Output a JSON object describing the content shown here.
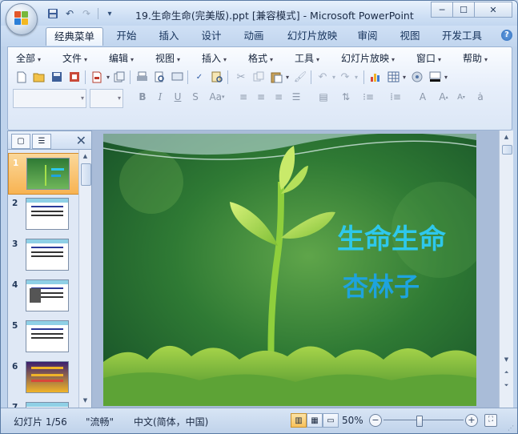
{
  "window": {
    "title": "19.生命生命(完美版).ppt [兼容模式] - Microsoft PowerPoint",
    "controls": {
      "minimize": "─",
      "maximize": "☐",
      "close": "✕"
    }
  },
  "qat": {
    "save_icon": "save-icon",
    "undo_icon": "undo-icon",
    "redo_icon": "redo-icon",
    "customize": "▾"
  },
  "tabs": [
    {
      "label": "经典菜单"
    },
    {
      "label": "开始"
    },
    {
      "label": "插入"
    },
    {
      "label": "设计"
    },
    {
      "label": "动画"
    },
    {
      "label": "幻灯片放映"
    },
    {
      "label": "审阅"
    },
    {
      "label": "视图"
    },
    {
      "label": "开发工具"
    }
  ],
  "help_label": "?",
  "menu": [
    {
      "label": "全部"
    },
    {
      "label": "文件"
    },
    {
      "label": "编辑"
    },
    {
      "label": "视图"
    },
    {
      "label": "插入"
    },
    {
      "label": "格式"
    },
    {
      "label": "工具"
    },
    {
      "label": "幻灯片放映"
    },
    {
      "label": "窗口"
    },
    {
      "label": "帮助"
    }
  ],
  "format_buttons": {
    "bold": "B",
    "italic": "I",
    "underline": "U",
    "strike": "S",
    "case": "Aa"
  },
  "slide": {
    "title": "生命生命",
    "subtitle": "杏林子",
    "title_color": "#2ec8ec",
    "subtitle_color": "#1ea3de"
  },
  "thumbnails": [
    {
      "number": "1",
      "selected": true
    },
    {
      "number": "2",
      "selected": false
    },
    {
      "number": "3",
      "selected": false
    },
    {
      "number": "4",
      "selected": false
    },
    {
      "number": "5",
      "selected": false
    },
    {
      "number": "6",
      "selected": false
    },
    {
      "number": "7",
      "selected": false
    }
  ],
  "status": {
    "slide_info": "幻灯片 1/56",
    "theme": "\"流畅\"",
    "language": "中文(简体，中国)",
    "zoom": "50%",
    "zoom_fraction": 0.45
  }
}
